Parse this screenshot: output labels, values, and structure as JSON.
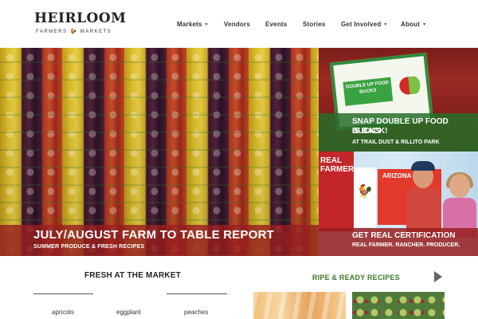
{
  "logo": {
    "main": "HEIRLOOM",
    "sub_left": "FARMERS",
    "sub_right": "MARKETS"
  },
  "nav": [
    {
      "label": "Markets",
      "dropdown": true
    },
    {
      "label": "Vendors",
      "dropdown": false
    },
    {
      "label": "Events",
      "dropdown": false
    },
    {
      "label": "Stories",
      "dropdown": false
    },
    {
      "label": "Get Involved",
      "dropdown": true
    },
    {
      "label": "About",
      "dropdown": true
    }
  ],
  "hero": {
    "title": "JULY/AUGUST FARM TO TABLE REPORT",
    "subtitle": "SUMMER PRODUCE & FRESH RECIPES"
  },
  "tiles": [
    {
      "title_line1": "SNAP DOUBLE UP FOOD BUCKS",
      "title_line2": "IS BACK!",
      "subtitle": "AT TRAIL DUST & RILLITO PARK",
      "sign_text": "DOUBLE UP FOOD BUCKS"
    },
    {
      "title": "GET REAL CERTIFICATION",
      "subtitle": "REAL FARMER. RANCHER. PRODUCER.",
      "banner_text": "REAL FARMER",
      "banner_az": "ARIZONA"
    }
  ],
  "fresh": {
    "title": "FRESH AT THE MARKET",
    "items": [
      "apricots",
      "eggplant",
      "peaches"
    ]
  },
  "recipes": {
    "title": "RIPE & READY RECIPES"
  },
  "colors": {
    "hero_band": "#961e1e",
    "snap_band": "#286e28",
    "ripe_green": "#3b7a2a"
  }
}
